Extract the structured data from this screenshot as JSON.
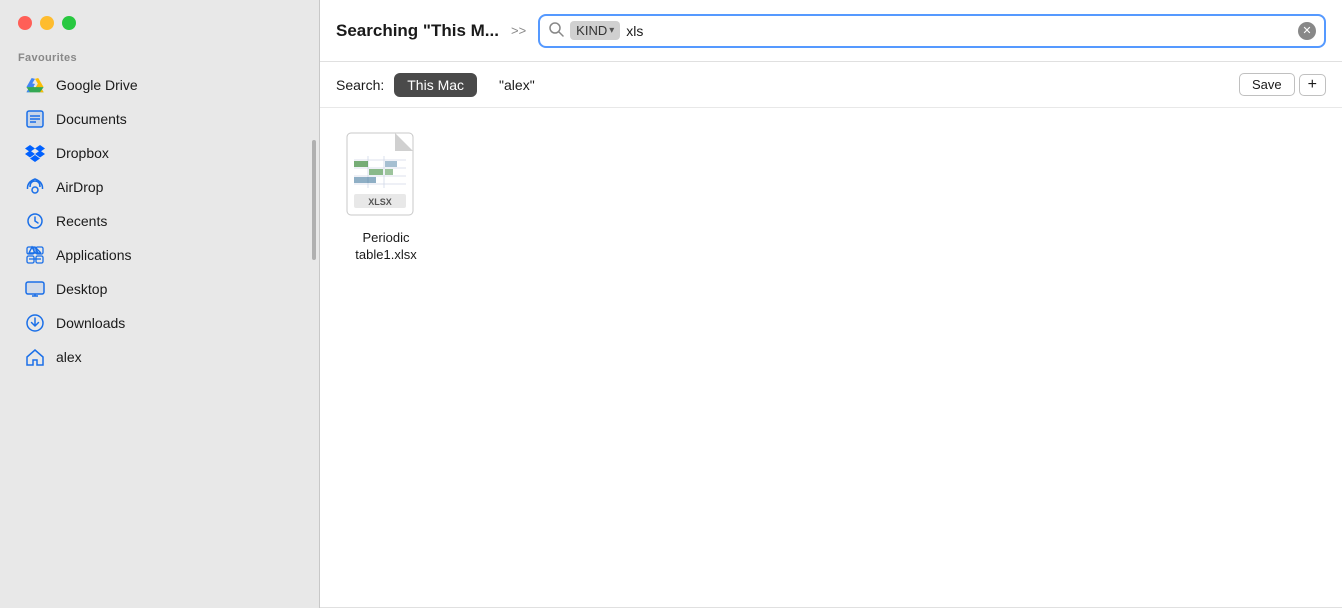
{
  "window": {
    "title": "Searching \"This M...",
    "controls": {
      "close": "close",
      "minimize": "minimize",
      "maximize": "maximize"
    }
  },
  "sidebar": {
    "favourites_label": "Favourites",
    "items": [
      {
        "id": "google-drive",
        "label": "Google Drive",
        "icon": "google-drive"
      },
      {
        "id": "documents",
        "label": "Documents",
        "icon": "documents"
      },
      {
        "id": "dropbox",
        "label": "Dropbox",
        "icon": "dropbox"
      },
      {
        "id": "airdrop",
        "label": "AirDrop",
        "icon": "airdrop"
      },
      {
        "id": "recents",
        "label": "Recents",
        "icon": "recents"
      },
      {
        "id": "applications",
        "label": "Applications",
        "icon": "applications"
      },
      {
        "id": "desktop",
        "label": "Desktop",
        "icon": "desktop"
      },
      {
        "id": "downloads",
        "label": "Downloads",
        "icon": "downloads"
      },
      {
        "id": "alex",
        "label": "alex",
        "icon": "home"
      }
    ]
  },
  "topbar": {
    "forward_arrows": ">>",
    "search": {
      "kind_label": "KIND",
      "search_value": "xls",
      "clear_label": "✕"
    }
  },
  "scope_bar": {
    "search_label": "Search:",
    "this_mac_label": "This Mac",
    "alex_label": "\"alex\"",
    "save_label": "Save",
    "plus_label": "+"
  },
  "files": [
    {
      "id": "periodic-table",
      "name": "Periodic\ntable1.xlsx",
      "type": "xlsx"
    }
  ]
}
